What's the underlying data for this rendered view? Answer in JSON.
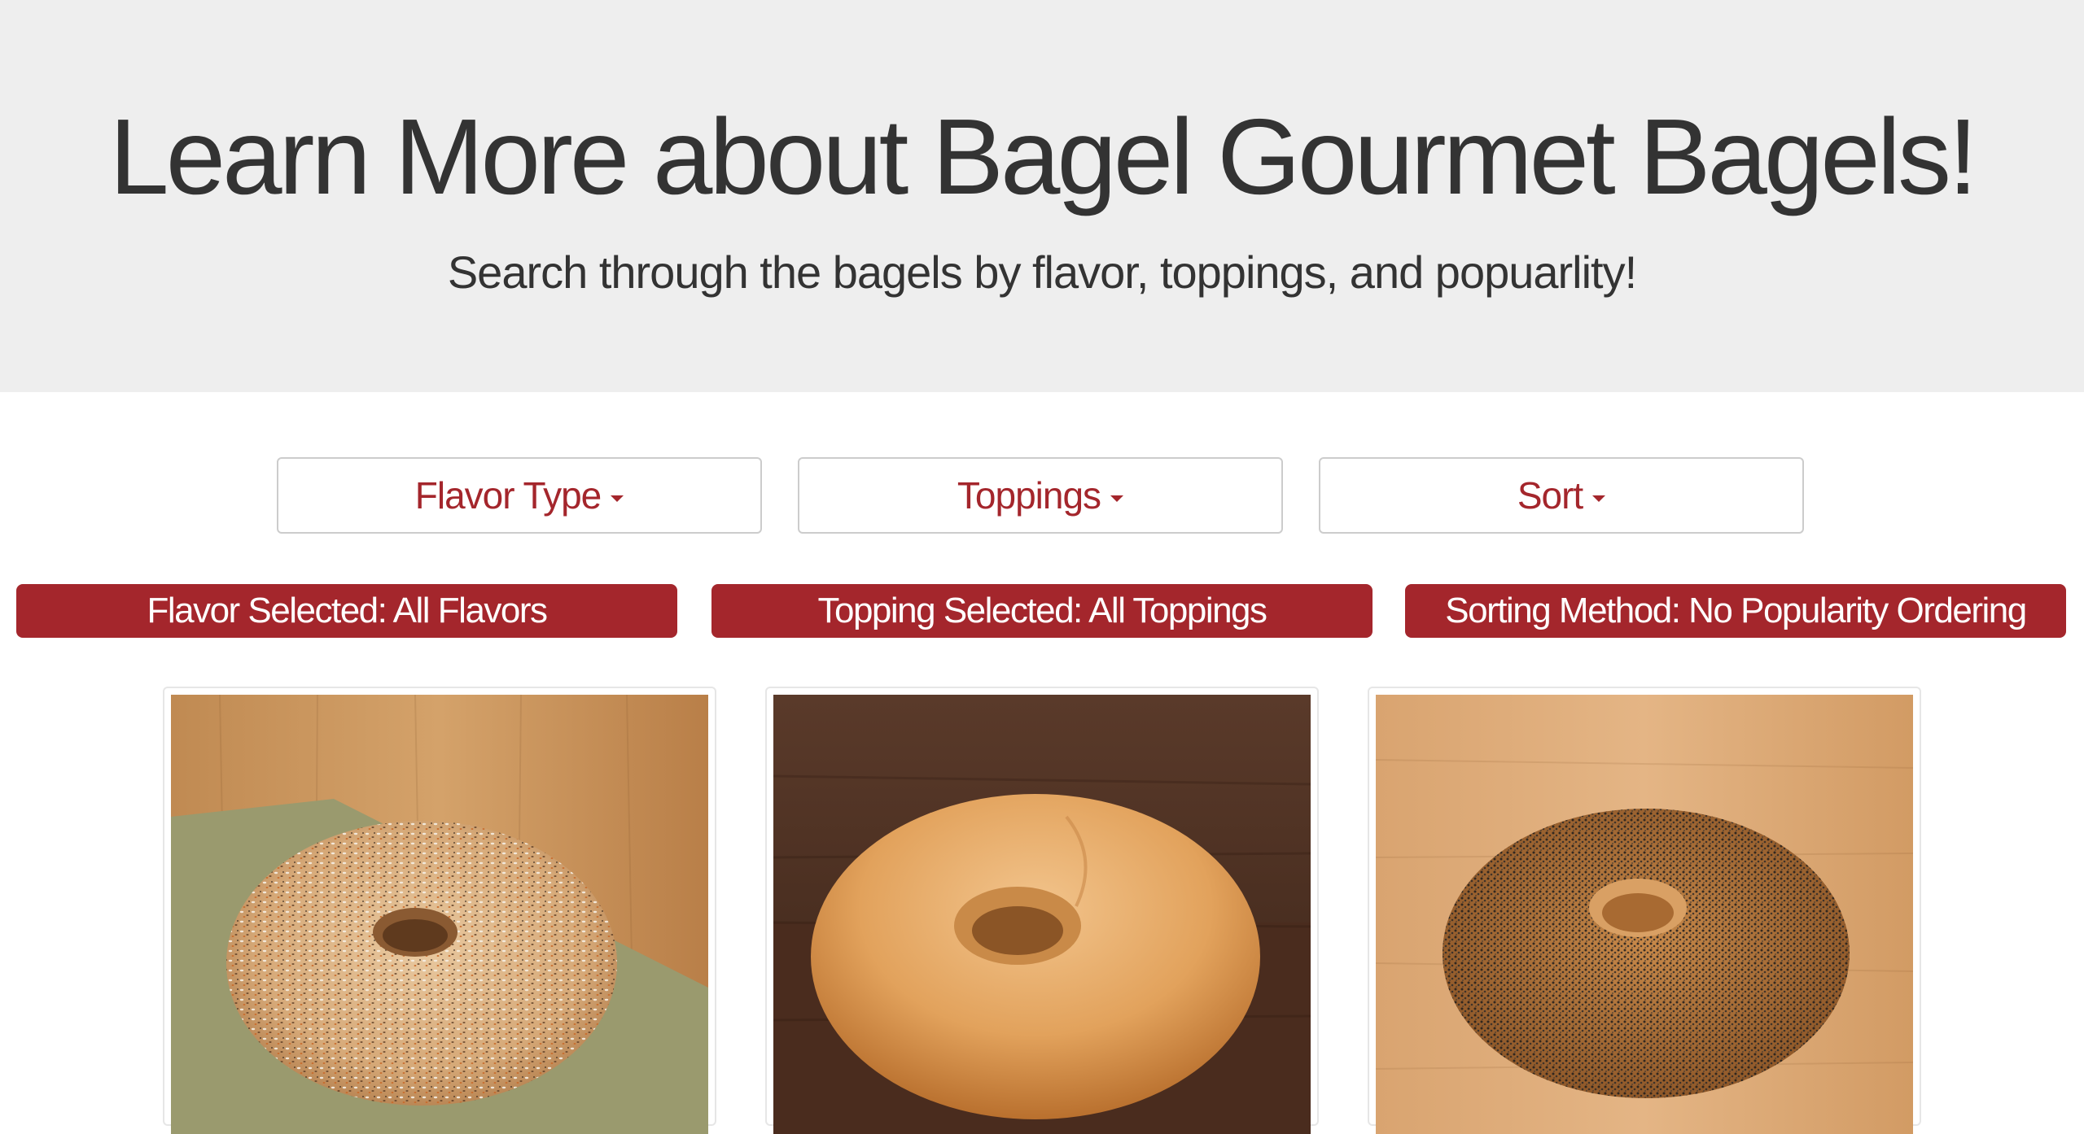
{
  "hero": {
    "title": "Learn More about Bagel Gourmet Bagels!",
    "subtitle": "Search through the bagels by flavor, toppings, and popuarlity!"
  },
  "filters": {
    "flavor_label": "Flavor Type",
    "toppings_label": "Toppings",
    "sort_label": "Sort"
  },
  "badges": {
    "flavor": "Flavor Selected: All Flavors",
    "topping": "Topping Selected: All Toppings",
    "sort": "Sorting Method: No Popularity Ordering"
  },
  "colors": {
    "accent": "#a4262c",
    "jumbotron_bg": "#eeeeee",
    "text": "#333333"
  },
  "cards": [
    {
      "image": "everything-bagel-image"
    },
    {
      "image": "plain-bagel-image"
    },
    {
      "image": "poppy-seed-bagel-image"
    }
  ]
}
